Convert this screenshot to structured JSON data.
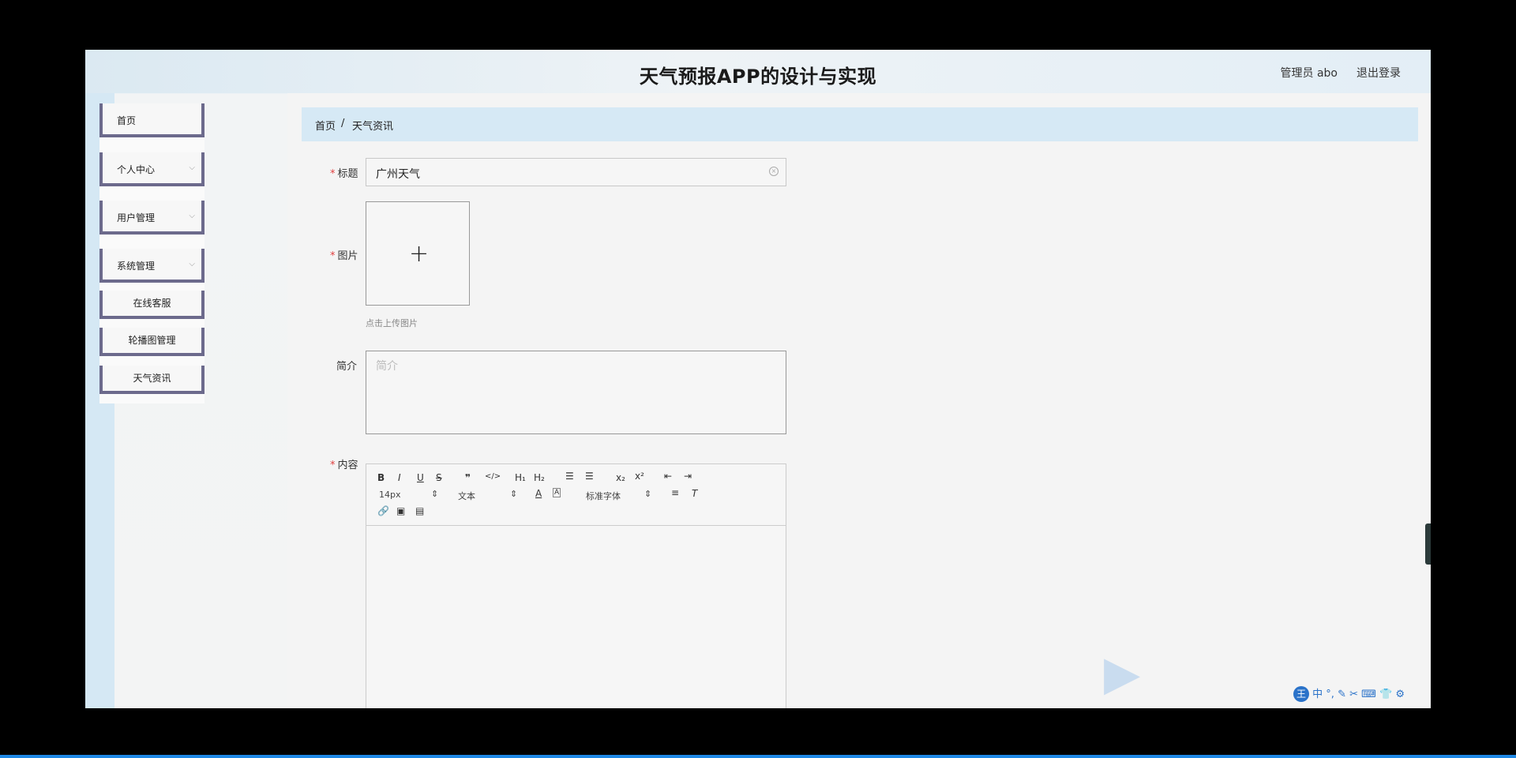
{
  "header": {
    "title": "天气预报APP的设计与实现",
    "user": "管理员 abo",
    "logout": "退出登录"
  },
  "sidebar": {
    "items": [
      {
        "label": "首页"
      },
      {
        "label": "个人中心"
      },
      {
        "label": "用户管理"
      },
      {
        "label": "系统管理"
      }
    ],
    "subitems": [
      {
        "label": "在线客服"
      },
      {
        "label": "轮播图管理"
      },
      {
        "label": "天气资讯"
      }
    ]
  },
  "breadcrumb": {
    "home": "首页",
    "separator": "/",
    "current": "天气资讯"
  },
  "form": {
    "title_label": "标题",
    "title_value": "广州天气",
    "image_label": "图片",
    "image_hint": "点击上传图片",
    "summary_label": "简介",
    "summary_placeholder": "简介",
    "content_label": "内容"
  },
  "editor": {
    "font_size": "14px",
    "format": "文本",
    "font_family": "标准字体"
  },
  "ime": {
    "badge": "王",
    "mode": "中"
  }
}
